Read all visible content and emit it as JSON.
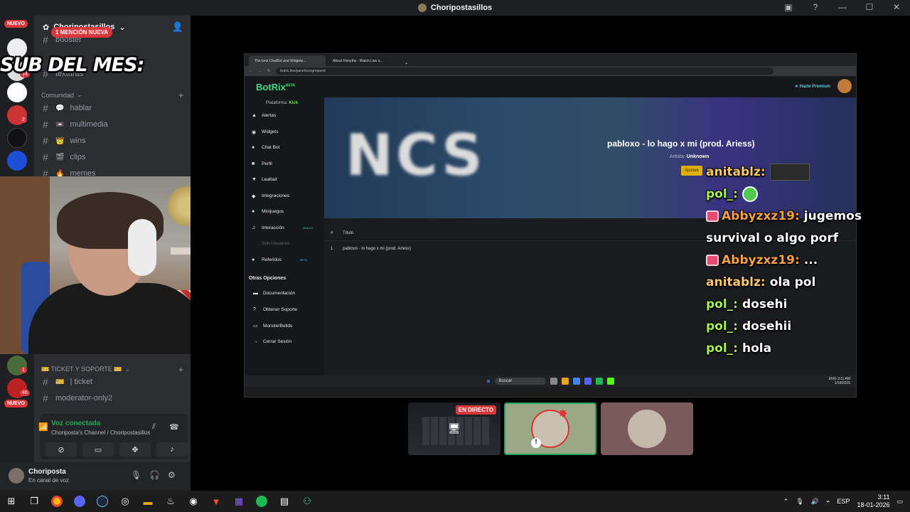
{
  "window": {
    "title": "Choripostasillos"
  },
  "rail": {
    "badge_new_top": "NUEVO",
    "badge_new_bottom": "NUEVO",
    "count_a": "14",
    "count_b": "2",
    "count_c": "46",
    "count_d": "1"
  },
  "server": {
    "name": "Choripostasillos",
    "mention_pill": "1 MENCIÓN NUEVA",
    "overlay_text": "SUB DEL MES:",
    "top_channels": [
      {
        "name": "booster"
      },
      {
        "name": "texturas"
      }
    ],
    "category_comunidad": "Comunidad",
    "channels": [
      {
        "name": "hablar",
        "emoji": "💬"
      },
      {
        "name": "multimedia",
        "emoji": "📼"
      },
      {
        "name": "wins",
        "emoji": "👑"
      },
      {
        "name": "clips",
        "emoji": "🎬"
      },
      {
        "name": "memes",
        "emoji": "🔥"
      }
    ],
    "category_ticket": "🎫 TICKET Y SOPORTE 🎫",
    "ticket_channels": [
      {
        "name": "| ticket",
        "emoji": "🎫"
      },
      {
        "name": "moderator-only2",
        "emoji": ""
      }
    ]
  },
  "voice": {
    "status": "Voz conectada",
    "channel": "Choriposta's Channel / Choripostasillos"
  },
  "user": {
    "name": "Choriposta",
    "status": "En canal de voz"
  },
  "browser": {
    "tab1": "The best ChatBot and Widgets...",
    "tab2": "About Finnyths - Watch Live o...",
    "url": "botrix.live/panel/songrequest",
    "logo": "BotRix",
    "logo_beta": "BETA",
    "premium": "★ Hazte Premium",
    "platform_label": "Plataforma:",
    "platform_value": "Kick",
    "nav": [
      {
        "label": "Alertas",
        "icon": "▲"
      },
      {
        "label": "Widgets",
        "icon": "◉"
      },
      {
        "label": "Chat Bot",
        "icon": "●"
      },
      {
        "label": "Perfil",
        "icon": "■"
      },
      {
        "label": "Lealtad",
        "icon": "▼"
      },
      {
        "label": "Integraciones",
        "icon": "◆"
      },
      {
        "label": "Minijuegos",
        "icon": "●"
      },
      {
        "label": "Interacción",
        "icon": "♫",
        "tag": "NUEVO"
      },
      {
        "label": "Sub-Usuarios",
        "icon": "",
        "dim": true
      },
      {
        "label": "Referidos",
        "icon": "●",
        "tag": "BETA"
      }
    ],
    "other_options_heading": "Otras Opciones",
    "other": [
      {
        "label": "Documentación",
        "icon": "▬"
      },
      {
        "label": "Obtener Soporte",
        "icon": "?"
      },
      {
        "label": "MonsterBuilds",
        "icon": "▭"
      },
      {
        "label": "Cerrar Sesión",
        "icon": "→"
      }
    ],
    "banner_text": "NCS",
    "song_title": "pabloxo - lo hago x mi (prod. Ariess)",
    "artist_label": "Artista:",
    "artist_value": "Unknown",
    "settings_btn": "Ajustes",
    "table_head_num": "#",
    "table_head_title": "Título",
    "rows": [
      {
        "num": "1",
        "title": "pabloxo - lo hago x mi (prod. Ariess)"
      }
    ],
    "taskbar_search": "Buscar",
    "taskbar_lang": "ENG",
    "taskbar_time": "3:11 AM",
    "taskbar_date": "1/18/2026"
  },
  "chat": [
    {
      "user": "anitablz:",
      "color": "#f6c96a",
      "text": "",
      "emote": "img"
    },
    {
      "user": "pol_:",
      "color": "#a3f24c",
      "text": "",
      "emote": "green"
    },
    {
      "user": "Abbyzxz19:",
      "color": "#f7a23c",
      "text": "jugemos",
      "heart": true
    },
    {
      "user": "",
      "color": "#ffffff",
      "text": "survival o algo porf"
    },
    {
      "user": "Abbyzxz19:",
      "color": "#f7a23c",
      "text": "...",
      "heart": true
    },
    {
      "user": "anitablz:",
      "color": "#f6c96a",
      "text": "ola pol"
    },
    {
      "user": "pol_:",
      "color": "#a3f24c",
      "text": "dosehi"
    },
    {
      "user": "pol_:",
      "color": "#a3f24c",
      "text": "dosehii"
    },
    {
      "user": "pol_:",
      "color": "#a3f24c",
      "text": "hola"
    }
  ],
  "tiles": {
    "live_badge": "EN DIRECTO"
  },
  "taskbar": {
    "lang": "ESP",
    "time": "3:11",
    "date": "18-01-2026"
  }
}
